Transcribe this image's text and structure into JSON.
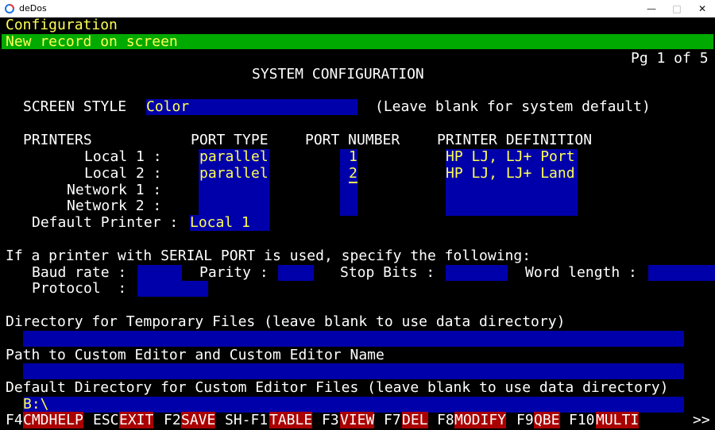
{
  "window": {
    "title": "deDos",
    "minimize_glyph": "—",
    "maximize_glyph": "□",
    "close_glyph": "✕",
    "icon": "dedos-app-icon"
  },
  "header": {
    "title": "Configuration",
    "status": "New record on screen",
    "page": "Pg 1 of 5",
    "heading": "SYSTEM CONFIGURATION"
  },
  "screen_style": {
    "label": "SCREEN STYLE",
    "value": "Color",
    "hint": "(Leave blank for system default)"
  },
  "printers": {
    "headers": {
      "printers": "PRINTERS",
      "port_type": "PORT TYPE",
      "port_number": "PORT NUMBER",
      "printer_definition": "PRINTER DEFINITION"
    },
    "rows": [
      {
        "label": "Local 1 :",
        "port_type": "parallel",
        "port_number": "1",
        "definition": "HP LJ, LJ+ Port"
      },
      {
        "label": "Local 2 :",
        "port_type": "parallel",
        "port_number": "2",
        "definition": "HP LJ, LJ+ Land"
      },
      {
        "label": "Network 1 :",
        "port_type": "",
        "port_number": "",
        "definition": ""
      },
      {
        "label": "Network 2 :",
        "port_type": "",
        "port_number": "",
        "definition": ""
      }
    ],
    "default_label": "Default Printer :",
    "default_value": "Local 1"
  },
  "serial": {
    "intro": "If a printer with SERIAL PORT is used, specify the following:",
    "baud_label": "Baud rate :",
    "baud_value": "",
    "parity_label": "Parity :",
    "parity_value": "",
    "stop_label": "Stop Bits :",
    "stop_value": "",
    "word_label": "Word length :",
    "word_value": "",
    "protocol_label": "Protocol  :",
    "protocol_value": ""
  },
  "directories": {
    "temp_label": "Directory for Temporary Files (leave blank to use data directory)",
    "temp_value": "",
    "editor_label": "Path to Custom Editor and Custom Editor Name",
    "editor_value": "",
    "editor_dir_label": "Default Directory for Custom Editor Files (leave blank to use data directory)",
    "editor_dir_value": "B:\\"
  },
  "fkeys": [
    {
      "key": "F4",
      "label": "CMDHELP"
    },
    {
      "key": "ESC",
      "label": "EXIT"
    },
    {
      "key": "F2",
      "label": "SAVE"
    },
    {
      "key": "SH-F1",
      "label": "TABLE"
    },
    {
      "key": "F3",
      "label": "VIEW"
    },
    {
      "key": "F7",
      "label": "DEL"
    },
    {
      "key": "F8",
      "label": "MODIFY"
    },
    {
      "key": "F9",
      "label": "QBE"
    },
    {
      "key": "F10",
      "label": "MULTI"
    }
  ],
  "more_indicator": ">>",
  "colors": {
    "background": "#000000",
    "text": "#ffff55",
    "field": "#0000aa",
    "status_bar": "#00aa00",
    "fkey_label": "#aa0000"
  }
}
